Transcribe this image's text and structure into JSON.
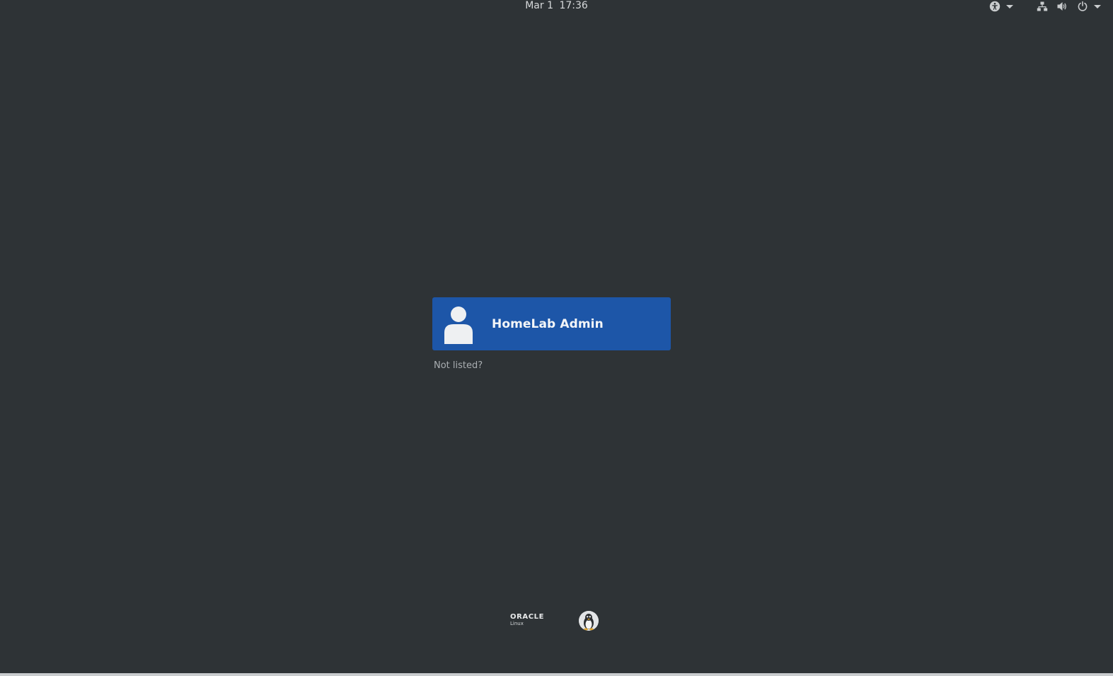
{
  "topbar": {
    "date": "Mar 1",
    "time": "17:36",
    "icons": {
      "accessibility": "accessibility-icon",
      "network": "network-wired-icon",
      "volume": "volume-icon",
      "power": "power-icon"
    }
  },
  "login": {
    "users": [
      {
        "name": "HomeLab Admin",
        "avatar": "default-user-icon"
      }
    ],
    "not_listed_label": "Not listed?"
  },
  "branding": {
    "oracle_word": "ORACLE",
    "oracle_sub": "Linux",
    "tux": "tux-penguin-icon"
  },
  "colors": {
    "background": "#2e3336",
    "selected_user": "#1d56a8",
    "text": "#d6d9db"
  }
}
